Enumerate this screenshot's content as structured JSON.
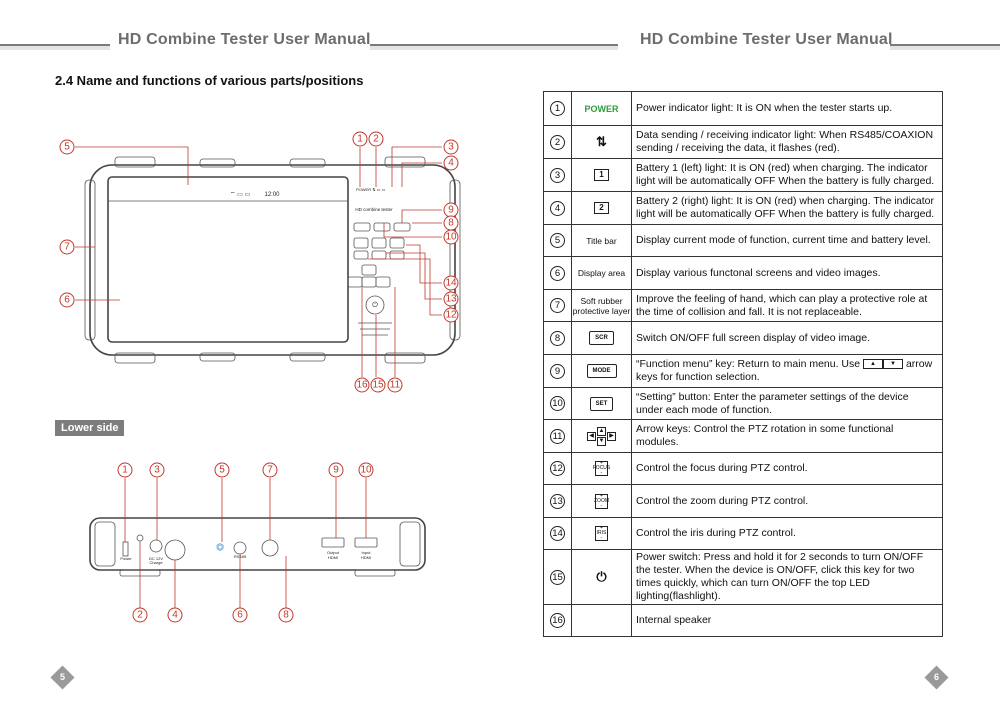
{
  "header": {
    "left_title": "HD Combine Tester User Manual",
    "right_title": "HD Combine Tester User Manual"
  },
  "section_title": "2.4 Name and functions of various parts/positions",
  "front_view": {
    "callouts": [
      "5",
      "1",
      "2",
      "3",
      "4",
      "9",
      "8",
      "10",
      "7",
      "14",
      "6",
      "13",
      "12",
      "16",
      "15",
      "11"
    ],
    "status_time": "12:00",
    "device_label": "HD combine tester",
    "panel_labels": {
      "power": "POWER",
      "mode": "MODE",
      "set": "SET",
      "scr": "SCR",
      "focus": "FOCUS",
      "zoom": "ZOOM",
      "iris": "IRIS"
    }
  },
  "lower_side": {
    "label": "Lower side",
    "callouts_top": [
      "1",
      "3",
      "5",
      "7",
      "9",
      "10"
    ],
    "callouts_bottom": [
      "2",
      "4",
      "6",
      "8"
    ],
    "port_labels": {
      "power": "Power",
      "dc_in": "DC 12V",
      "charge": "Charge",
      "rs485": "RS485",
      "output": "Output",
      "input": "Input",
      "output_hdmi": "HDMI",
      "input_hdmi": "HDMI"
    }
  },
  "table": {
    "rows": [
      {
        "num": "1",
        "icon": "POWER",
        "icon_type": "power-text",
        "desc": "Power indicator light: It is ON when the tester starts up."
      },
      {
        "num": "2",
        "icon": "⇅",
        "icon_type": "glyph",
        "desc": "Data sending / receiving indicator light: When RS485/COAXION sending / receiving the data, it flashes (red)."
      },
      {
        "num": "3",
        "icon": "1",
        "icon_type": "battery",
        "desc": "Battery 1 (left) light: It is ON (red) when charging. The indicator light will be automatically OFF When the battery is fully charged."
      },
      {
        "num": "4",
        "icon": "2",
        "icon_type": "battery",
        "desc": "Battery 2 (right) light: It is ON (red) when charging. The indicator light will be automatically OFF When the battery is fully charged."
      },
      {
        "num": "5",
        "icon": "Title bar",
        "icon_type": "text",
        "desc": "Display current mode of function, current time and battery level."
      },
      {
        "num": "6",
        "icon": "Display area",
        "icon_type": "text",
        "desc": "Display various functonal screens and video images."
      },
      {
        "num": "7",
        "icon": "Soft rubber protective layer",
        "icon_type": "text",
        "desc": "Improve the feeling of hand, which can play a protective role at the time of collision and fall. It is not replaceable."
      },
      {
        "num": "8",
        "icon": "SCR",
        "icon_type": "key",
        "desc": "Switch ON/OFF full screen display of video image."
      },
      {
        "num": "9",
        "icon": "MODE",
        "icon_type": "key",
        "desc_a": "“Function menu” key: Return to main menu. Use",
        "desc_b": "arrow keys for function selection."
      },
      {
        "num": "10",
        "icon": "SET",
        "icon_type": "key",
        "desc": "“Setting” button: Enter the parameter settings of the device under each mode of function."
      },
      {
        "num": "11",
        "icon": "arrows",
        "icon_type": "arrows",
        "desc": "Arrow keys: Control the PTZ rotation in some functional modules."
      },
      {
        "num": "12",
        "icon": "FOCUS",
        "icon_type": "small-key",
        "desc": "Control the focus during PTZ control."
      },
      {
        "num": "13",
        "icon": "ZOOM",
        "icon_type": "small-key",
        "desc": "Control the zoom during PTZ control."
      },
      {
        "num": "14",
        "icon": "IRIS",
        "icon_type": "small-key",
        "desc": "Control the iris during PTZ control."
      },
      {
        "num": "15",
        "icon": "⏻",
        "icon_type": "glyph",
        "desc": "Power switch: Press and hold it for 2 seconds to turn ON/OFF the tester. When the device is ON/OFF, click this key for two times quickly, which can turn ON/OFF the top LED lighting(flashlight)."
      },
      {
        "num": "16",
        "icon": "",
        "icon_type": "none",
        "desc": "Internal speaker"
      }
    ]
  },
  "page_numbers": {
    "left": "5",
    "right": "6"
  },
  "colors": {
    "callout": "#c0392b",
    "power_green": "#2e9d3e",
    "header_gray": "#6d6d6d",
    "page_marker": "#9a9a9a"
  }
}
